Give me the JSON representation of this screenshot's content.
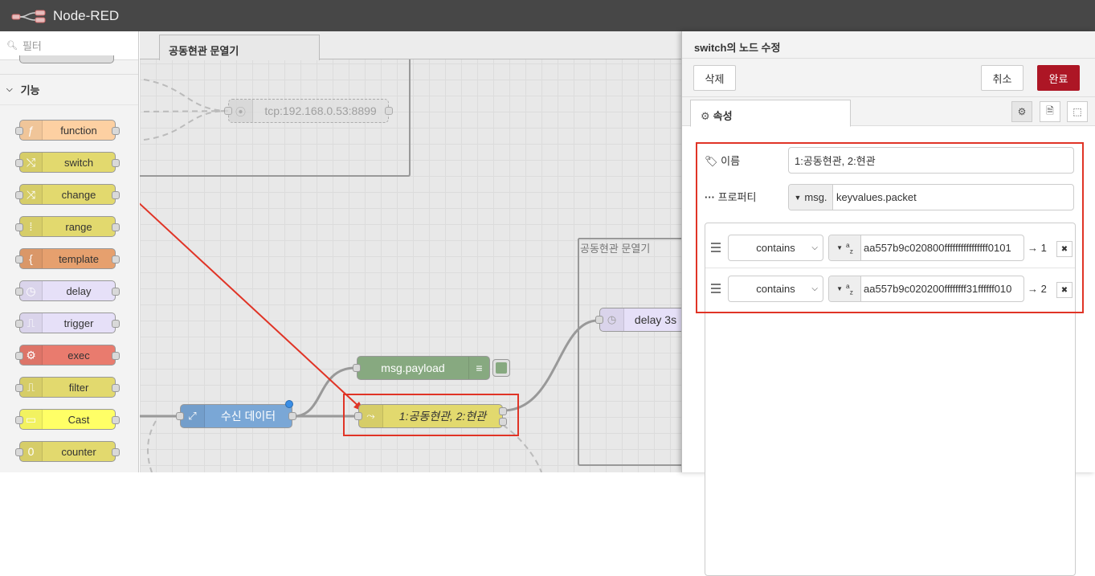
{
  "header": {
    "title": "Node-RED"
  },
  "palette": {
    "filter_placeholder": "필터",
    "category": "기능",
    "nodes": [
      {
        "label": "function",
        "color": "#fdd0a2",
        "icon": "function-icon",
        "glyph": "ƒ"
      },
      {
        "label": "switch",
        "color": "#e2d96e",
        "icon": "switch-icon",
        "glyph": "⤭"
      },
      {
        "label": "change",
        "color": "#e2d96e",
        "icon": "shuffle-icon",
        "glyph": "⤨"
      },
      {
        "label": "range",
        "color": "#e2d96e",
        "icon": "range-icon",
        "glyph": "⁞"
      },
      {
        "label": "template",
        "color": "#e6a06e",
        "icon": "brace-icon",
        "glyph": "{"
      },
      {
        "label": "delay",
        "color": "#e6e0f8",
        "icon": "timer-icon",
        "glyph": "◷"
      },
      {
        "label": "trigger",
        "color": "#e6e0f8",
        "icon": "trigger-icon",
        "glyph": "⎍"
      },
      {
        "label": "exec",
        "color": "#e97b6e",
        "icon": "gear-icon",
        "glyph": "⚙"
      },
      {
        "label": "filter",
        "color": "#e2d96e",
        "icon": "filter-icon",
        "glyph": "⎍"
      },
      {
        "label": "Cast",
        "color": "#ffff66",
        "icon": "cast-icon",
        "glyph": "▭"
      },
      {
        "label": "counter",
        "color": "#e2d96e",
        "icon": "counter-icon",
        "glyph": "0"
      }
    ]
  },
  "workspace": {
    "tab_label": "공동현관 문열기",
    "group_label": "공동현관 문열기",
    "nodes": {
      "tcp": "tcp:192.168.0.53:8899",
      "debug": "msg.payload",
      "receive": "수신 데이터",
      "switch": "1:공동현관, 2:현관",
      "delay": "delay 3s"
    }
  },
  "editor": {
    "title": "switch의 노드 수정",
    "delete_label": "삭제",
    "cancel_label": "취소",
    "done_label": "완료",
    "tab_properties": "속성",
    "name_label": "이름",
    "name_value": "1:공동현관, 2:현관",
    "property_label": "프로퍼티",
    "property_type": "msg.",
    "property_value": "keyvalues.packet",
    "rules": [
      {
        "op": "contains",
        "value": "aa557b9c020800ffffffffffffffff0101",
        "output": "→ 1"
      },
      {
        "op": "contains",
        "value": "aa557b9c020200ffffffff31ffffff010",
        "output": "→ 2"
      }
    ]
  },
  "colors": {
    "accent": "#ad1625",
    "highlight": "#e03426"
  }
}
